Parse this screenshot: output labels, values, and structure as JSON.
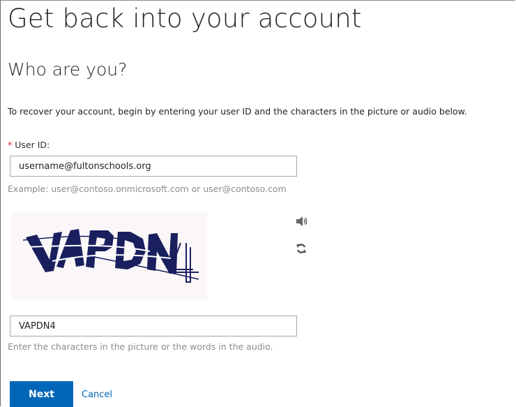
{
  "page": {
    "title": "Get back into your account",
    "subtitle": "Who are you?",
    "instruction": "To recover your account, begin by entering your user ID and the characters in the picture or audio below."
  },
  "userid": {
    "required_mark": "*",
    "label": "User ID:",
    "value": "username@fultonschools.org",
    "hint": "Example: user@contoso.onmicrosoft.com or user@contoso.com"
  },
  "captcha": {
    "image_text": "VAPDN4",
    "audio_icon": "speaker-icon",
    "refresh_icon": "refresh-icon",
    "answer_value": "VAPDN4",
    "hint": "Enter the characters in the picture or the words in the audio."
  },
  "actions": {
    "next_label": "Next",
    "cancel_label": "Cancel"
  },
  "colors": {
    "accent": "#0067b8",
    "required": "#e81123",
    "captcha_ink": "#1a1f5e"
  }
}
